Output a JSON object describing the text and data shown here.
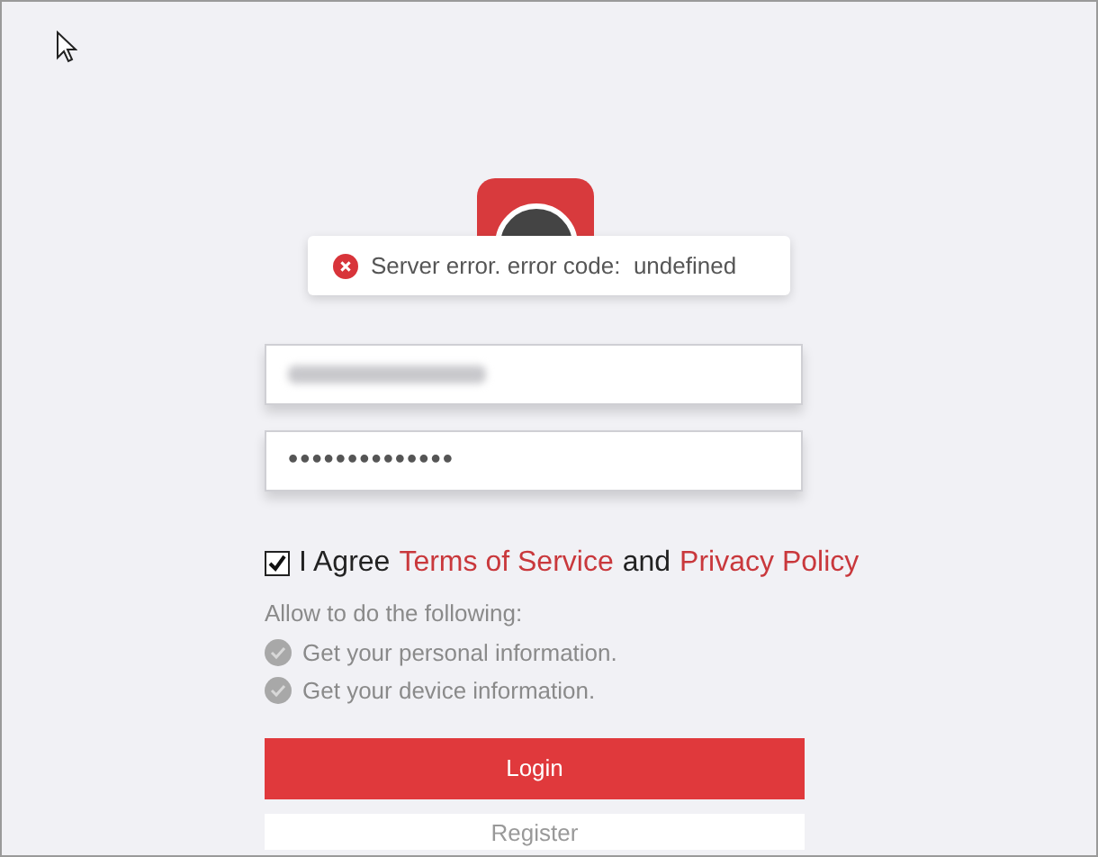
{
  "toast": {
    "message": "Server error. error code:  undefined"
  },
  "username_field": {
    "blurred": true
  },
  "password_field": {
    "value": "••••••••••••••"
  },
  "agreement": {
    "checked": true,
    "prefix": "I Agree",
    "terms_link": "Terms of Service",
    "joiner": "and",
    "privacy_link": "Privacy Policy"
  },
  "permissions": {
    "heading": "Allow to do the following:",
    "items": [
      {
        "label": "Get your personal information."
      },
      {
        "label": "Get your device information."
      }
    ]
  },
  "buttons": [
    {
      "kind": "primary",
      "label": "Login"
    },
    {
      "kind": "secondary",
      "label": "Register"
    }
  ]
}
